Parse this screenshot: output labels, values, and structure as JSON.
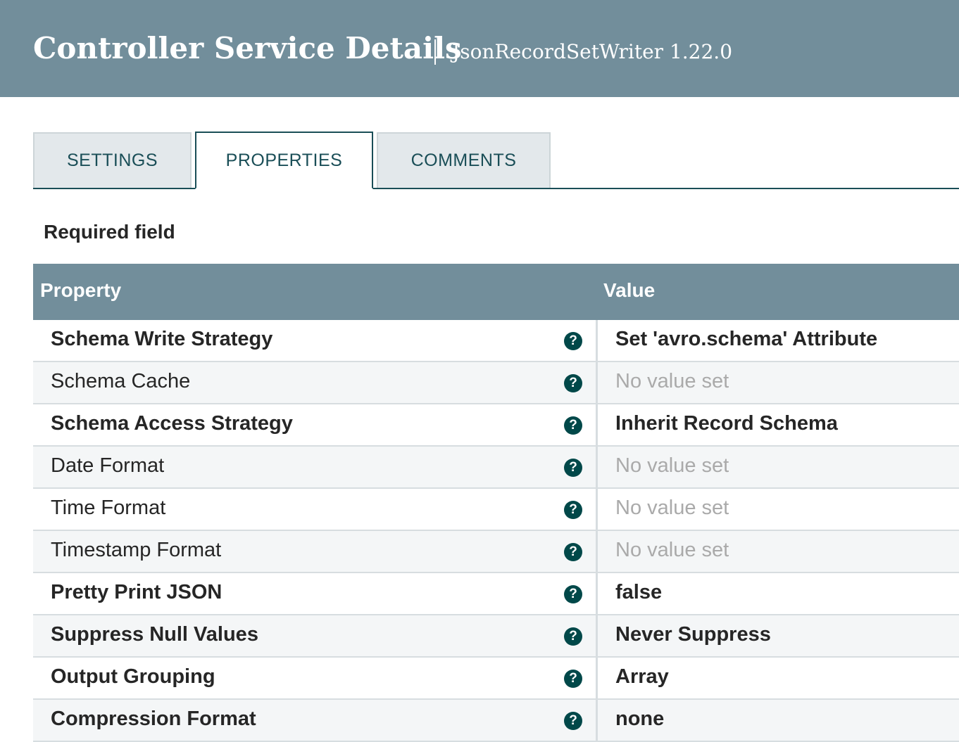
{
  "header": {
    "title": "Controller Service Details",
    "subtitle": "JsonRecordSetWriter 1.22.0"
  },
  "tabs": [
    {
      "label": "SETTINGS",
      "active": false
    },
    {
      "label": "PROPERTIES",
      "active": true
    },
    {
      "label": "COMMENTS",
      "active": false
    }
  ],
  "required_label": "Required field",
  "table": {
    "columns": {
      "property": "Property",
      "value": "Value"
    },
    "rows": [
      {
        "name": "Schema Write Strategy",
        "value": "Set 'avro.schema' Attribute",
        "required": true,
        "set": true,
        "help_icon": "question-circle-icon"
      },
      {
        "name": "Schema Cache",
        "value": "No value set",
        "required": false,
        "set": false,
        "help_icon": "question-circle-icon"
      },
      {
        "name": "Schema Access Strategy",
        "value": "Inherit Record Schema",
        "required": true,
        "set": true,
        "help_icon": "question-circle-icon"
      },
      {
        "name": "Date Format",
        "value": "No value set",
        "required": false,
        "set": false,
        "help_icon": "question-circle-icon"
      },
      {
        "name": "Time Format",
        "value": "No value set",
        "required": false,
        "set": false,
        "help_icon": "question-circle-icon"
      },
      {
        "name": "Timestamp Format",
        "value": "No value set",
        "required": false,
        "set": false,
        "help_icon": "question-circle-icon"
      },
      {
        "name": "Pretty Print JSON",
        "value": "false",
        "required": true,
        "set": true,
        "help_icon": "question-circle-icon"
      },
      {
        "name": "Suppress Null Values",
        "value": "Never Suppress",
        "required": true,
        "set": true,
        "help_icon": "question-circle-icon"
      },
      {
        "name": "Output Grouping",
        "value": "Array",
        "required": true,
        "set": true,
        "help_icon": "question-circle-icon"
      },
      {
        "name": "Compression Format",
        "value": "none",
        "required": true,
        "set": true,
        "help_icon": "question-circle-icon"
      }
    ]
  },
  "colors": {
    "header_bg": "#728e9b",
    "tab_accent": "#1a4e57",
    "help_icon_bg": "#004849",
    "unset_value": "#aaaaaa"
  }
}
